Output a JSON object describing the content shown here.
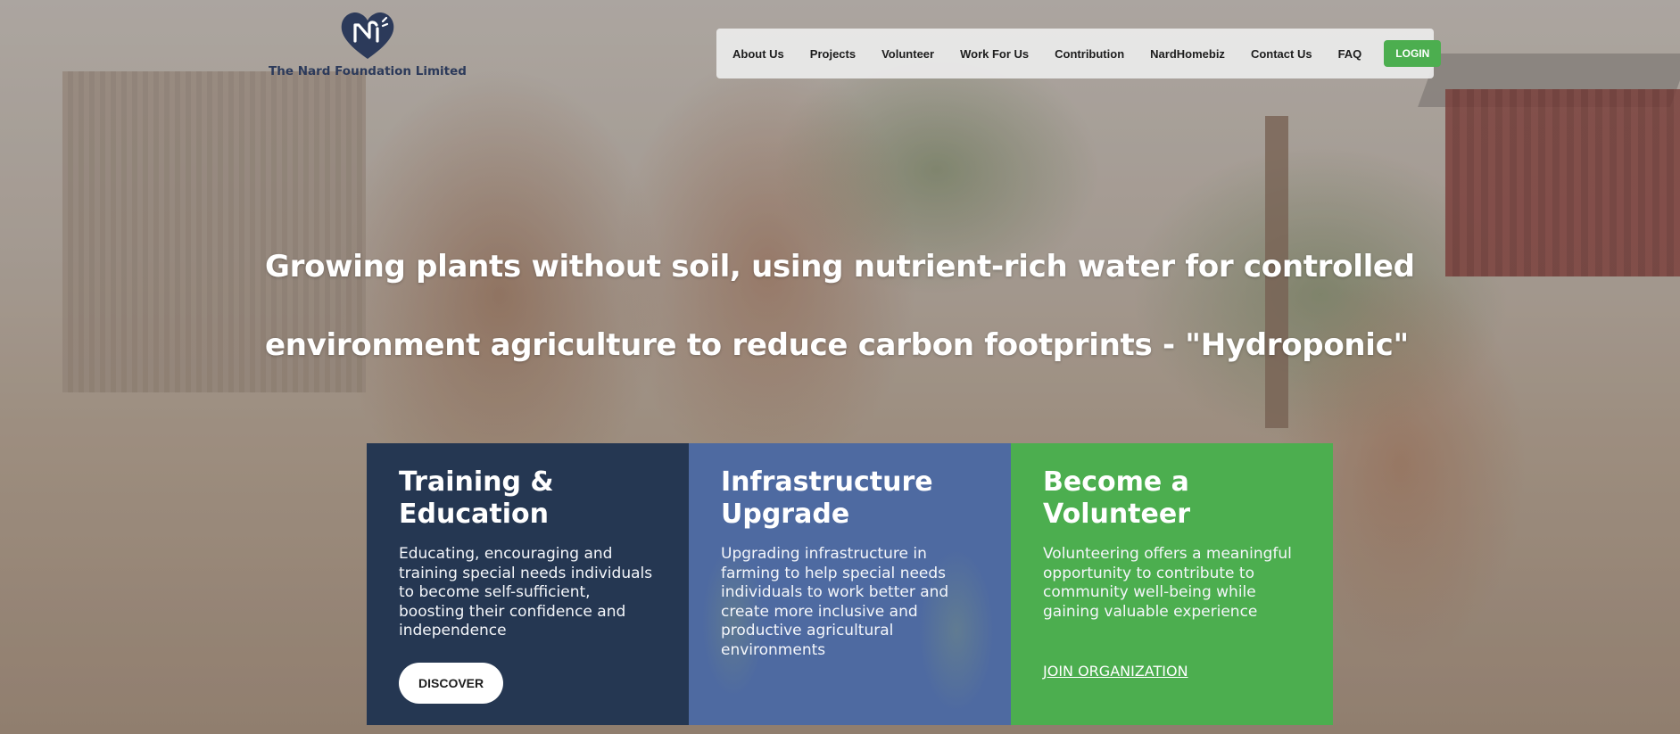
{
  "brand": {
    "name": "The Nard Foundation Limited",
    "logo_icon": "heart-n-logo-icon",
    "primary_color": "#2c3a5a",
    "accent_color": "#4cae4f"
  },
  "nav": {
    "items": [
      {
        "label": "About Us"
      },
      {
        "label": "Projects"
      },
      {
        "label": "Volunteer"
      },
      {
        "label": "Work For Us"
      },
      {
        "label": "Contribution"
      },
      {
        "label": "NardHomebiz"
      },
      {
        "label": "Contact Us"
      },
      {
        "label": "FAQ"
      }
    ],
    "login_label": "LOGIN"
  },
  "hero": {
    "headline": "Growing plants without soil, using nutrient-rich water for controlled environment agriculture to reduce carbon footprints - \"Hydroponic\""
  },
  "cards": [
    {
      "title_line1": "Training &",
      "title_line2": "Education",
      "text": "Educating, encouraging and training special needs individuals to become self-sufficient, boosting their confidence and independence",
      "button_label": "DISCOVER",
      "color": "#253752"
    },
    {
      "title_line1": "Infrastructure",
      "title_line2": "Upgrade",
      "text": "Upgrading infrastructure in farming to help special needs individuals to work better and create more inclusive and productive agricultural environments",
      "color": "#4b69a5"
    },
    {
      "title_line1": "Become a",
      "title_line2": "Volunteer",
      "text": "Volunteering offers a meaningful opportunity to contribute to community well-being while gaining valuable experience",
      "link_label": "JOIN ORGANIZATION",
      "color": "#4cae4f"
    }
  ]
}
